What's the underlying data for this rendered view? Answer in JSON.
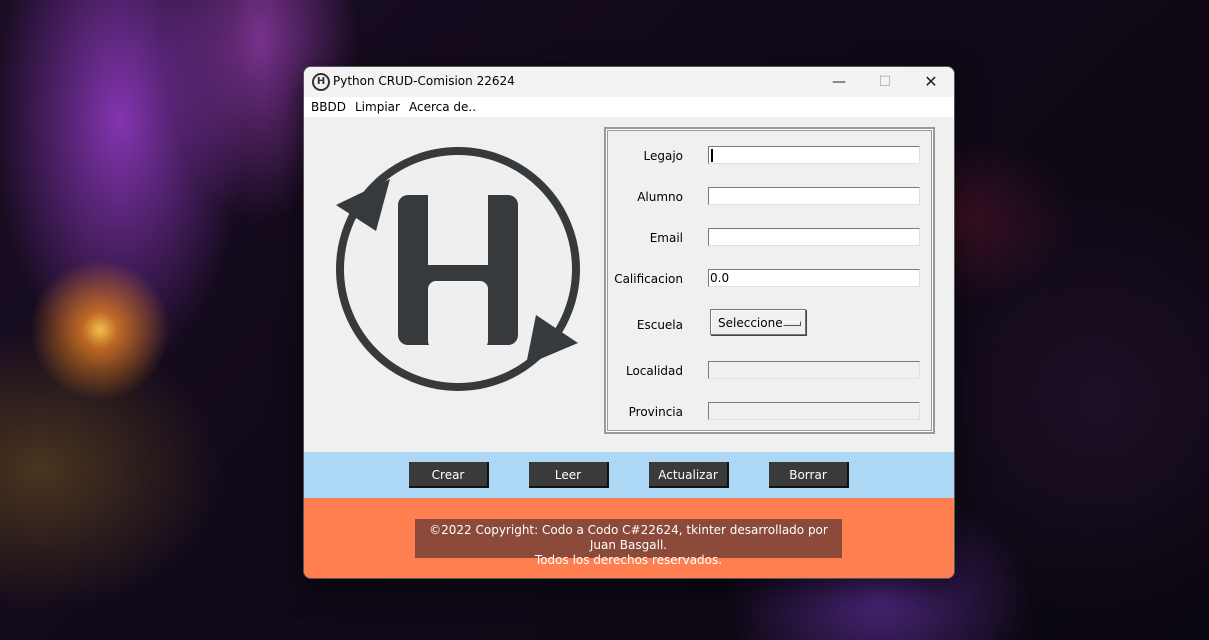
{
  "window": {
    "title": "Python CRUD-Comision 22624",
    "app_icon_letter": "H",
    "controls": {
      "minimize": "—",
      "maximize": "☐",
      "close": "✕"
    }
  },
  "menu": {
    "items": [
      "BBDD",
      "Limpiar",
      "Acerca de.."
    ]
  },
  "logo": {
    "icon": "h-cycle-logo-icon"
  },
  "form": {
    "fields": [
      {
        "label": "Legajo",
        "value": "",
        "enabled": true,
        "focused": true
      },
      {
        "label": "Alumno",
        "value": "",
        "enabled": true
      },
      {
        "label": "Email",
        "value": "",
        "enabled": true
      },
      {
        "label": "Calificacion",
        "value": "0.0",
        "enabled": true
      },
      {
        "label": "Escuela",
        "type": "select",
        "selected": "Seleccione"
      },
      {
        "label": "Localidad",
        "value": "",
        "enabled": false
      },
      {
        "label": "Provincia",
        "value": "",
        "enabled": false
      }
    ]
  },
  "buttons": [
    "Crear",
    "Leer",
    "Actualizar",
    "Borrar"
  ],
  "footer": {
    "line1": "©2022 Copyright: Codo a Codo C#22624, tkinter desarrollado por Juan Basgall.",
    "line2": "Todos los derechos reservados."
  },
  "colors": {
    "button_bar": "#add8f5",
    "footer_bg": "#ff7f50",
    "copyright_bg": "#8b4a3a",
    "button_bg": "#3a3a3a"
  }
}
